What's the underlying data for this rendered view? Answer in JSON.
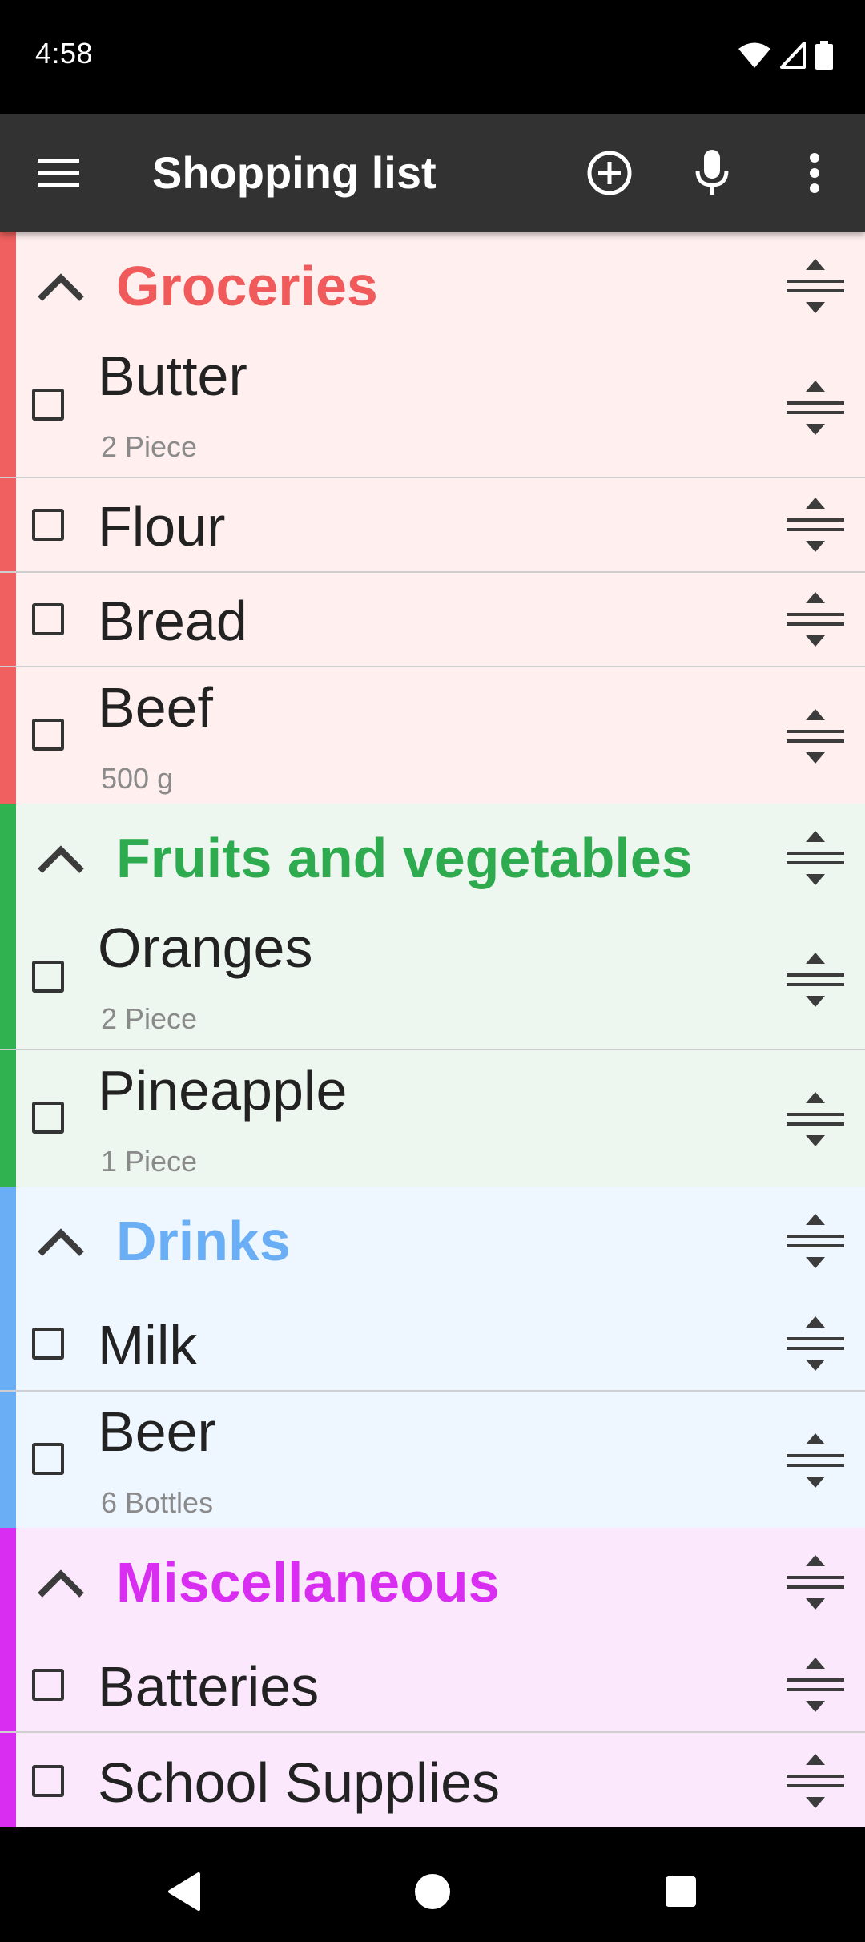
{
  "status_bar": {
    "time": "4:58"
  },
  "app_bar": {
    "title": "Shopping list"
  },
  "sections": [
    {
      "title": "Groceries",
      "color": "#f05a5a",
      "stripe": "#f06060",
      "bg": "#fff0ef",
      "items": [
        {
          "name": "Butter",
          "quantity": "2 Piece"
        },
        {
          "name": "Flour",
          "quantity": ""
        },
        {
          "name": "Bread",
          "quantity": ""
        },
        {
          "name": "Beef",
          "quantity": "500 g"
        }
      ]
    },
    {
      "title": "Fruits and vegetables",
      "color": "#2eaa4f",
      "stripe": "#2fb24f",
      "bg": "#edf7ef",
      "items": [
        {
          "name": "Oranges",
          "quantity": "2 Piece"
        },
        {
          "name": "Pineapple",
          "quantity": "1 Piece"
        }
      ]
    },
    {
      "title": "Drinks",
      "color": "#6aaef5",
      "stripe": "#6aaef5",
      "bg": "#eef6ff",
      "items": [
        {
          "name": "Milk",
          "quantity": ""
        },
        {
          "name": "Beer",
          "quantity": "6 Bottles"
        }
      ]
    },
    {
      "title": "Miscellaneous",
      "color": "#d92ef2",
      "stripe": "#d92ef2",
      "bg": "#fbe8fd",
      "items": [
        {
          "name": "Batteries",
          "quantity": ""
        },
        {
          "name": "School Supplies",
          "quantity": ""
        }
      ]
    }
  ]
}
